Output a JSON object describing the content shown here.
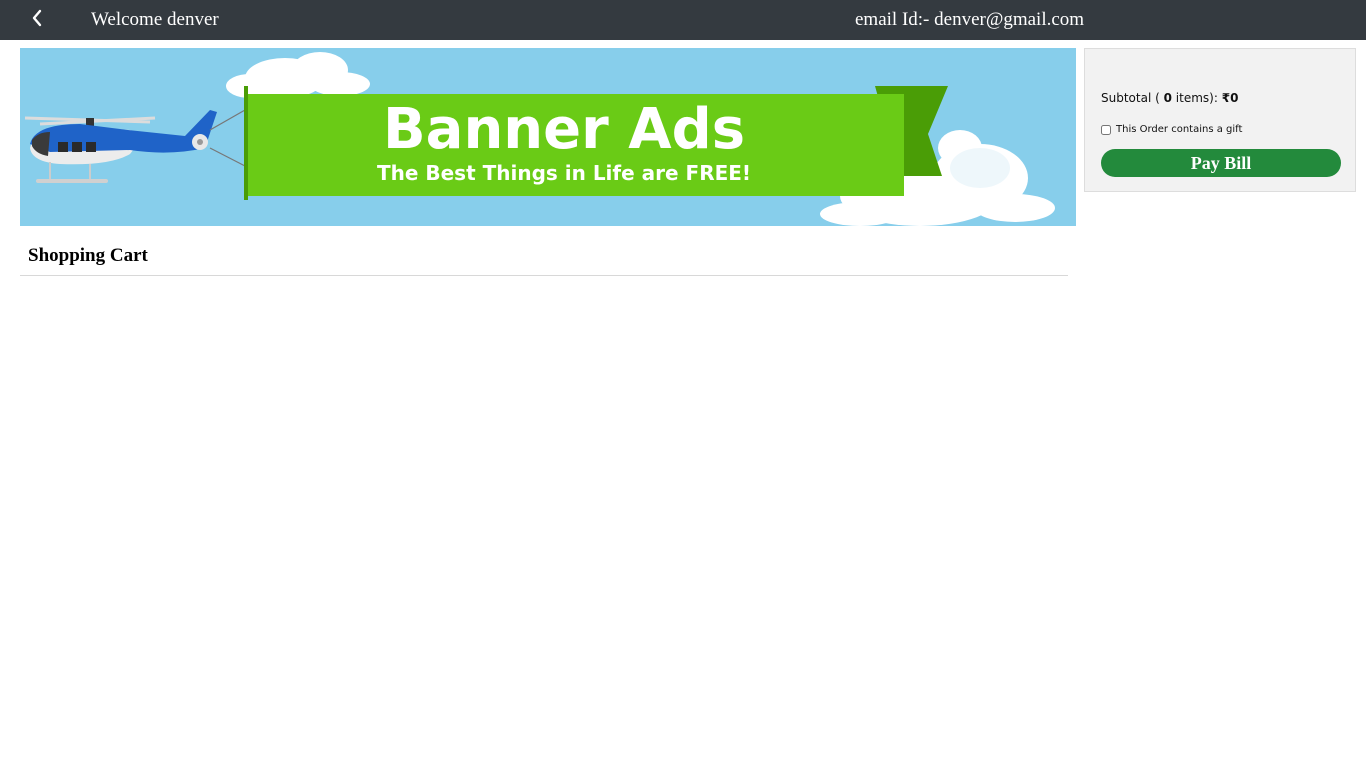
{
  "header": {
    "back_icon": "chevron-left-icon",
    "welcome_text": "Welcome denver",
    "email_text": "email Id:- denver@gmail.com"
  },
  "banner": {
    "headline": "Banner Ads",
    "tagline": "The Best Things in Life are FREE!",
    "colors": {
      "sky": "#87ceeb",
      "flag": "#6acb16",
      "flag_dark": "#4a9d06"
    }
  },
  "cart": {
    "title": "Shopping Cart"
  },
  "summary": {
    "subtotal_prefix": "Subtotal (",
    "item_count": "0",
    "items_suffix": "items):",
    "amount": "₹0",
    "gift_label": "This Order contains a gift",
    "gift_checked": false,
    "pay_button_label": "Pay Bill",
    "pay_button_color": "#238a3c"
  },
  "colors": {
    "topbar": "#343a40",
    "summary_bg": "#f2f2f2"
  }
}
